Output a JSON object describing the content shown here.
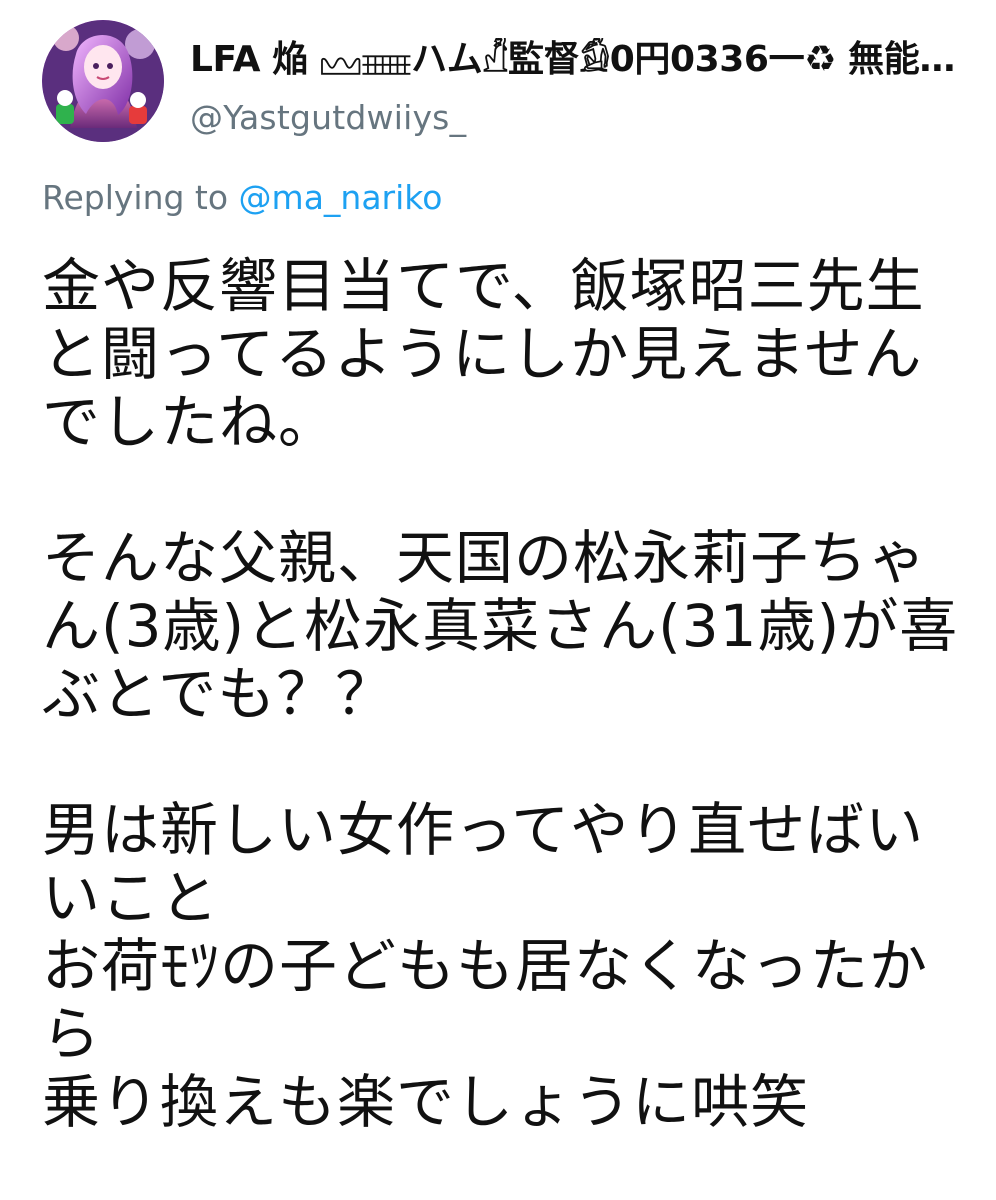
{
  "tweet": {
    "display_name": "LFA 焔 𓈊𓈈ハム𓀯監督𓀁0円0336一♻ 無能で…",
    "handle": "@Yastgutdwiiys_",
    "replying_prefix": "Replying to",
    "replying_to": "@ma_nariko",
    "body_lines": [
      "金や反響目当てで、飯塚昭三先生",
      "と闘ってるようにしか見えません",
      "でしたね。",
      "",
      "そんな父親、天国の松永莉子ちゃ",
      "ん(3歳)と松永真菜さん(31歳)が喜",
      "ぶとでも？？",
      "",
      "男は新しい女作ってやり直せばい",
      "いこと",
      "お荷ﾓﾂの子どもも居なくなったか",
      "ら",
      "乗り換えも楽でしょうに哄笑"
    ]
  },
  "colors": {
    "text": "#111111",
    "muted": "#66757f",
    "link": "#1da1f2"
  },
  "icons": {
    "avatar": "profile-avatar"
  }
}
